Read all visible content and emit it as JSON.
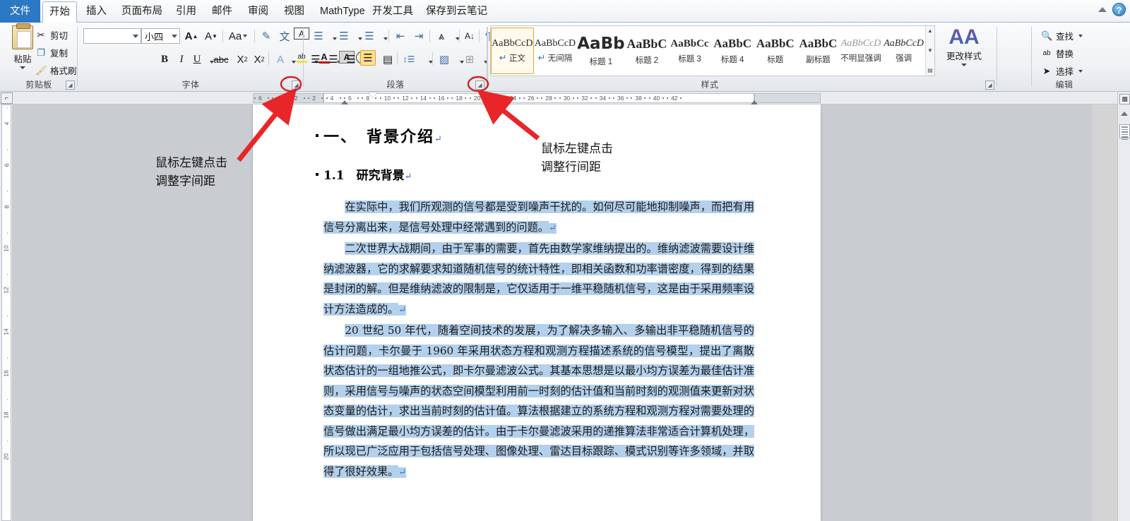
{
  "window": {
    "help_icon": "help-icon",
    "minimize_ribbon_icon": "caret-up-icon"
  },
  "tabs": [
    {
      "label": "文件",
      "kind": "file"
    },
    {
      "label": "开始",
      "kind": "active"
    },
    {
      "label": "插入",
      "kind": "normal"
    },
    {
      "label": "页面布局",
      "kind": "normal"
    },
    {
      "label": "引用",
      "kind": "normal"
    },
    {
      "label": "邮件",
      "kind": "normal"
    },
    {
      "label": "审阅",
      "kind": "normal"
    },
    {
      "label": "视图",
      "kind": "normal"
    },
    {
      "label": "MathType",
      "kind": "normal"
    },
    {
      "label": "开发工具",
      "kind": "normal"
    },
    {
      "label": "保存到云笔记",
      "kind": "normal"
    }
  ],
  "ribbon": {
    "clipboard": {
      "group_label": "剪贴板",
      "paste_label": "粘贴",
      "items": [
        {
          "label": "剪切",
          "icon": "scissors-icon"
        },
        {
          "label": "复制",
          "icon": "copy-icon"
        },
        {
          "label": "格式刷",
          "icon": "format-painter-icon"
        }
      ]
    },
    "font": {
      "group_label": "字体",
      "font_name_value": "",
      "font_size_value": "小四",
      "buttons": [
        {
          "name": "grow-font",
          "glyph": "A"
        },
        {
          "name": "shrink-font",
          "glyph": "A"
        },
        {
          "name": "change-case",
          "glyph": "Aa"
        },
        {
          "name": "clear-formatting",
          "glyph": "A"
        },
        {
          "name": "phonetic-guide",
          "glyph": "文"
        },
        {
          "name": "character-border",
          "glyph": "A"
        },
        {
          "name": "bold",
          "glyph": "B"
        },
        {
          "name": "italic",
          "glyph": "I"
        },
        {
          "name": "underline",
          "glyph": "U"
        },
        {
          "name": "strikethrough",
          "glyph": "abc"
        },
        {
          "name": "subscript",
          "glyph": "X₂"
        },
        {
          "name": "superscript",
          "glyph": "X²"
        },
        {
          "name": "text-effects",
          "glyph": "A"
        },
        {
          "name": "highlight-color",
          "glyph": "ab"
        },
        {
          "name": "font-color",
          "glyph": "A"
        },
        {
          "name": "character-shading",
          "glyph": "A"
        },
        {
          "name": "enclose-characters",
          "glyph": "字"
        }
      ]
    },
    "paragraph": {
      "group_label": "段落",
      "buttons": [
        {
          "name": "bullets",
          "glyph": "≔"
        },
        {
          "name": "numbering",
          "glyph": "≕"
        },
        {
          "name": "multilevel-list",
          "glyph": "≟"
        },
        {
          "name": "decrease-indent",
          "glyph": "⇤"
        },
        {
          "name": "increase-indent",
          "glyph": "⇥"
        },
        {
          "name": "sort",
          "glyph": "↑↓"
        },
        {
          "name": "asian-sort",
          "glyph": "A↓"
        },
        {
          "name": "show-formatting-marks",
          "glyph": "¶"
        },
        {
          "name": "align-left",
          "glyph": "≡"
        },
        {
          "name": "align-center",
          "glyph": "≡"
        },
        {
          "name": "align-right",
          "glyph": "≡"
        },
        {
          "name": "justify",
          "glyph": "≡",
          "active": true
        },
        {
          "name": "distribute",
          "glyph": "▤"
        },
        {
          "name": "line-spacing",
          "glyph": "↕≡"
        },
        {
          "name": "shading",
          "glyph": "▨"
        },
        {
          "name": "borders",
          "glyph": "⊞"
        }
      ]
    },
    "styles": {
      "group_label": "样式",
      "items": [
        {
          "sample": "AaBbCcD",
          "name": "正文",
          "pilcrow": true,
          "selected": true,
          "style": "normal"
        },
        {
          "sample": "AaBbCcD",
          "name": "无间隔",
          "pilcrow": true,
          "selected": false,
          "style": "normal"
        },
        {
          "sample": "AaBb",
          "name": "标题 1",
          "pilcrow": false,
          "selected": false,
          "style": "h1"
        },
        {
          "sample": "AaBbC",
          "name": "标题 2",
          "pilcrow": false,
          "selected": false,
          "style": "h2"
        },
        {
          "sample": "AaBbCc",
          "name": "标题 3",
          "pilcrow": false,
          "selected": false,
          "style": "h3"
        },
        {
          "sample": "AaBbC",
          "name": "标题 4",
          "pilcrow": false,
          "selected": false,
          "style": "h4"
        },
        {
          "sample": "AaBbC",
          "name": "标题",
          "pilcrow": false,
          "selected": false,
          "style": "title"
        },
        {
          "sample": "AaBbC",
          "name": "副标题",
          "pilcrow": false,
          "selected": false,
          "style": "subtitle"
        },
        {
          "sample": "AaBbCcD",
          "name": "不明显强调",
          "pilcrow": false,
          "selected": false,
          "style": "subtle"
        },
        {
          "sample": "AaBbCcD",
          "name": "强调",
          "pilcrow": false,
          "selected": false,
          "style": "emph"
        }
      ],
      "change_styles_label": "更改样式"
    },
    "editing": {
      "group_label": "编辑",
      "items": [
        {
          "label": "查找",
          "icon": "binoculars-icon",
          "has_caret": true
        },
        {
          "label": "替换",
          "icon": "replace-icon",
          "has_caret": false
        },
        {
          "label": "选择",
          "icon": "cursor-icon",
          "has_caret": true
        }
      ]
    }
  },
  "rulers": {
    "corner_tab_icon": "tab-stop-left-icon",
    "horizontal_ticks": [
      "6",
      "4",
      "2",
      "2",
      "4",
      "6",
      "8",
      "10",
      "12",
      "14",
      "16",
      "18",
      "20",
      "22",
      "24",
      "26",
      "28",
      "30",
      "32",
      "34",
      "36",
      "38",
      "40",
      "42"
    ],
    "vertical_ticks": [
      "4",
      "6",
      "8",
      "10",
      "12",
      "14",
      "16",
      "18",
      "20"
    ]
  },
  "document": {
    "heading1": "一、　背景介绍",
    "heading2": "1.1　研究背景",
    "pilcrow": "↵",
    "paragraphs": [
      "在实际中，我们所观测的信号都是受到噪声干扰的。如何尽可能地抑制噪声，而把有用信号分离出来，是信号处理中经常遇到的问题。",
      "二次世界大战期间，由于军事的需要，首先由数学家维纳提出的。维纳滤波需要设计维纳滤波器，它的求解要求知道随机信号的统计特性，即相关函数和功率谱密度，得到的结果是封闭的解。但是维纳滤波的限制是，它仅适用于一维平稳随机信号，这是由于采用频率设计方法造成的。",
      "20 世纪 50 年代，随着空间技术的发展，为了解决多输入、多输出非平稳随机信号的估计问题，卡尔曼于 1960 年采用状态方程和观测方程描述系统的信号模型，提出了离散状态估计的一组地推公式，即卡尔曼滤波公式。其基本思想是以最小均方误差为最佳估计准则，采用信号与噪声的状态空间模型利用前一时刻的估计值和当前时刻的观测值来更新对状态变量的估计，求出当前时刻的估计值。算法根据建立的系统方程和观测方程对需要处理的信号做出满足最小均方误差的估计。由于卡尔曼滤波采用的递推算法非常适合计算机处理，所以现已广泛应用于包括信号处理、图像处理、雷达目标跟踪、模式识别等许多领域，并取得了很好效果。"
    ],
    "selection_color": "#b3d0ec"
  },
  "annotations": [
    {
      "name": "annotation-char-spacing",
      "text": "鼠标左键点击\n调整字间距",
      "target": "font-dialog-launcher"
    },
    {
      "name": "annotation-line-spacing",
      "text": "鼠标左键点击\n调整行间距",
      "target": "paragraph-dialog-launcher"
    }
  ],
  "colors": {
    "arrow_red": "#e8262a",
    "circle_red": "#d21f26",
    "tab_blue": "#2b78c4",
    "selection": "#b3d0ec",
    "accent_gold": "#e0a726"
  },
  "right_rail": {
    "select_browse_object_icon": "browse-object-icon",
    "previous_page_icon": "previous-page-icon",
    "next_page_icon": "next-page-icon"
  }
}
